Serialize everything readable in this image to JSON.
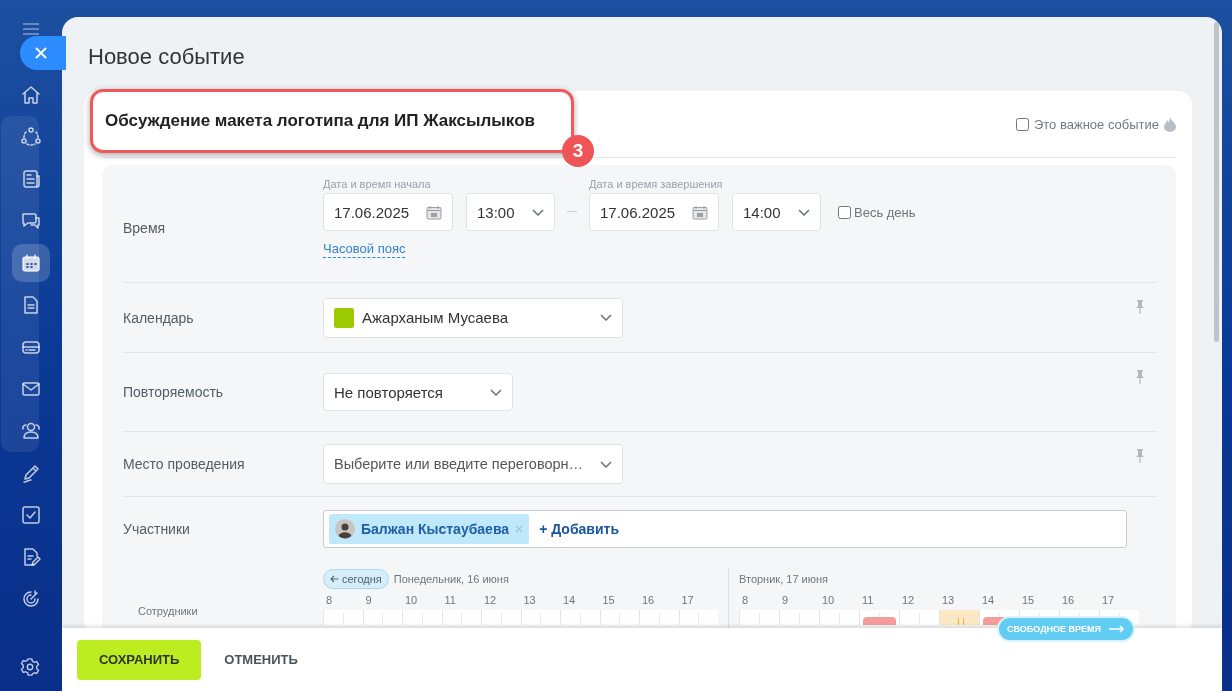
{
  "sidebar": {
    "items": [
      {
        "selected": false
      },
      {
        "selected": false
      },
      {
        "selected": false
      },
      {
        "selected": false
      },
      {
        "selected": true
      },
      {
        "selected": false
      },
      {
        "selected": false
      },
      {
        "selected": false
      },
      {
        "selected": false
      },
      {
        "selected": false
      },
      {
        "selected": false
      },
      {
        "selected": false
      },
      {
        "selected": false
      }
    ]
  },
  "window": {
    "title": "Новое событие"
  },
  "event_title": "Обсуждение макета логотипа для ИП Жаксылыков",
  "callout": "3",
  "important": {
    "label": "Это важное событие",
    "checked": false
  },
  "time": {
    "label": "Время",
    "start_caption": "Дата и время начала",
    "start_date": "17.06.2025",
    "start_time": "13:00",
    "end_caption": "Дата и время завершения",
    "end_date": "17.06.2025",
    "end_time": "14:00",
    "all_day": {
      "label": "Весь день",
      "checked": false
    },
    "timezone_link": "Часовой пояс"
  },
  "calendar": {
    "label": "Календарь",
    "value": "Ажарханым Мусаева",
    "color": "#9bcb00"
  },
  "repeat": {
    "label": "Повторяемость",
    "value": "Не повторяется"
  },
  "location": {
    "label": "Место проведения",
    "placeholder": "Выберите или введите переговорн…"
  },
  "participants": {
    "label": "Участники",
    "people": [
      {
        "name": "Балжан Кыстаубаева"
      }
    ],
    "add_link": "+ Добавить"
  },
  "planner": {
    "today_button": "сегодня",
    "employees_heading": "Сотрудники",
    "free_time_button": "СВОБОДНОЕ ВРЕМЯ",
    "days": [
      {
        "label": "Понедельник, 16 июня",
        "hours": [
          {
            "label": "8",
            "kind": "free"
          },
          {
            "label": "9",
            "kind": "free"
          },
          {
            "label": "10",
            "kind": "free"
          },
          {
            "label": "11",
            "kind": "free"
          },
          {
            "label": "12",
            "kind": "free"
          },
          {
            "label": "13",
            "kind": "free"
          },
          {
            "label": "14",
            "kind": "free"
          },
          {
            "label": "15",
            "kind": "free"
          },
          {
            "label": "16",
            "kind": "free"
          },
          {
            "label": "17",
            "kind": "free"
          }
        ]
      },
      {
        "label": "Вторник, 17 июня",
        "hours": [
          {
            "label": "8",
            "kind": "free"
          },
          {
            "label": "9",
            "kind": "free"
          },
          {
            "label": "10",
            "kind": "free"
          },
          {
            "label": "11",
            "kind": "busy"
          },
          {
            "label": "12",
            "kind": "free"
          },
          {
            "label": "13",
            "kind": "selected"
          },
          {
            "label": "14",
            "kind": "busy"
          },
          {
            "label": "15",
            "kind": "free"
          },
          {
            "label": "16",
            "kind": "free"
          },
          {
            "label": "17",
            "kind": "free"
          }
        ]
      }
    ]
  },
  "buttons": {
    "save": "СОХРАНИТЬ",
    "cancel": "ОТМЕНИТЬ"
  }
}
